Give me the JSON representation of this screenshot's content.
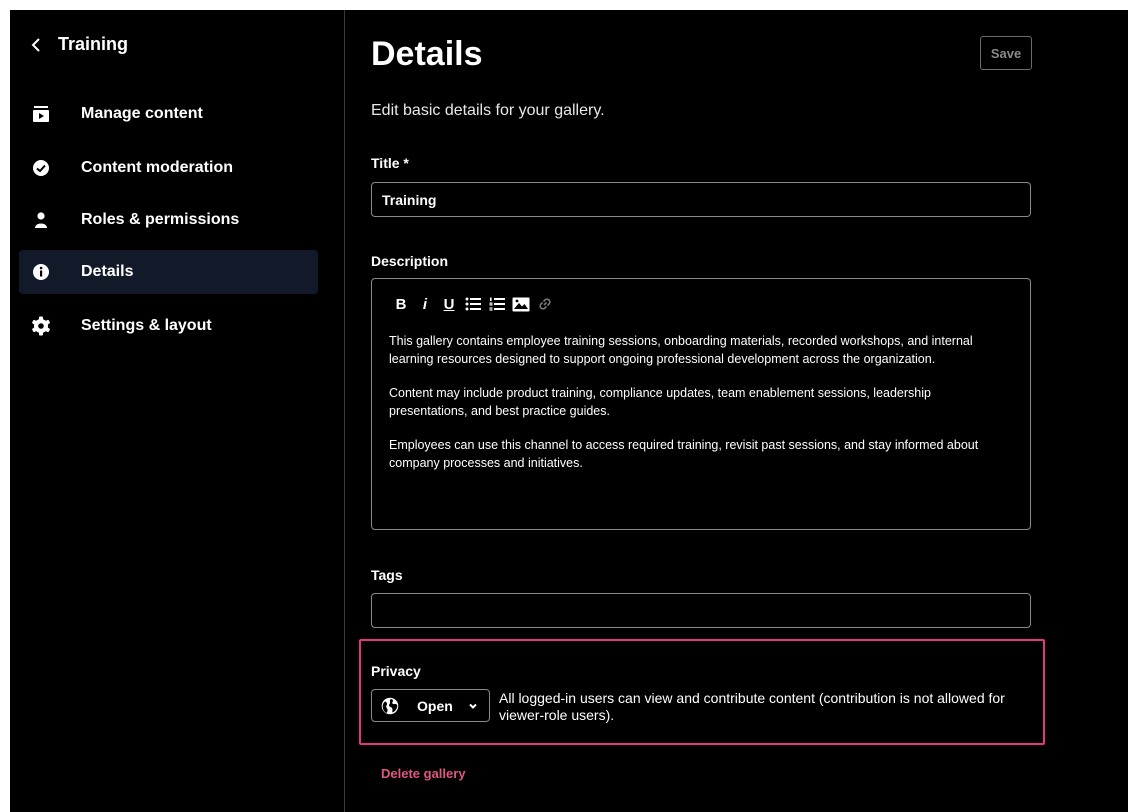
{
  "sidebar": {
    "back_title": "Training",
    "items": [
      {
        "label": "Manage content",
        "icon": "video-playlist-icon"
      },
      {
        "label": "Content moderation",
        "icon": "check-circle-icon"
      },
      {
        "label": "Roles & permissions",
        "icon": "user-icon"
      },
      {
        "label": "Details",
        "icon": "info-circle-icon",
        "active": true
      },
      {
        "label": "Settings & layout",
        "icon": "gear-icon"
      }
    ]
  },
  "main": {
    "title": "Details",
    "save_label": "Save",
    "subtitle": "Edit basic details for your gallery.",
    "title_field": {
      "label": "Title *",
      "value": "Training"
    },
    "description": {
      "label": "Description",
      "toolbar": [
        "B",
        "i",
        "U"
      ],
      "paragraphs": [
        "This gallery contains employee training sessions, onboarding materials, recorded workshops, and internal learning resources designed to support ongoing professional development across the organization.",
        "Content may include product training, compliance updates, team enablement sessions, leadership presentations, and best practice guides.",
        "Employees can use this channel to access required training, revisit past sessions, and stay informed about company processes and initiatives."
      ]
    },
    "tags": {
      "label": "Tags",
      "value": ""
    },
    "privacy": {
      "label": "Privacy",
      "selected": "Open",
      "description": "All logged-in users can view and contribute content (contribution is not allowed for viewer-role users)."
    },
    "delete_label": "Delete gallery"
  },
  "colors": {
    "background": "#000000",
    "active_nav": "#121a29",
    "highlight_border": "#e5357a",
    "danger": "#e0577f"
  }
}
